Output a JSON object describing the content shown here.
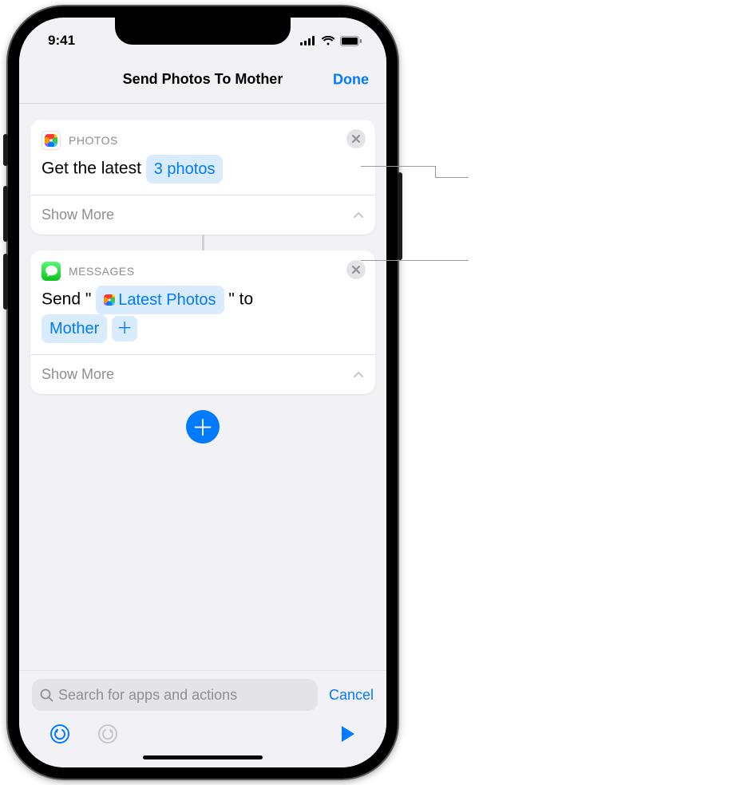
{
  "status": {
    "time": "9:41"
  },
  "nav": {
    "title": "Send Photos To Mother",
    "done": "Done"
  },
  "actions": {
    "photos": {
      "app_label": "PHOTOS",
      "prefix": "Get the latest",
      "param": "3 photos",
      "show_more": "Show More"
    },
    "messages": {
      "app_label": "MESSAGES",
      "send_word": "Send",
      "open_quote": "\"",
      "variable": "Latest Photos",
      "close_quote": "\"",
      "to_word": "to",
      "recipient": "Mother",
      "show_more": "Show More"
    }
  },
  "search": {
    "placeholder": "Search for apps and actions",
    "cancel": "Cancel"
  }
}
